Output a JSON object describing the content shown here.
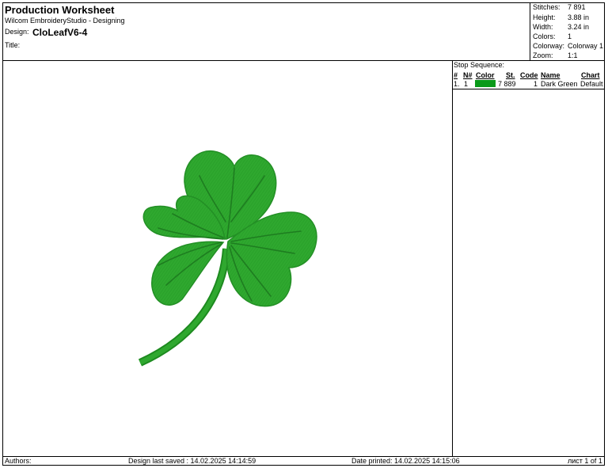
{
  "header": {
    "title": "Production Worksheet",
    "software": "Wilcom EmbroideryStudio - Designing",
    "design_label": "Design:",
    "design_value": "CloLeafV6-4",
    "title_label": "Title:"
  },
  "stats": [
    {
      "label": "Stitches:",
      "value": "7 891"
    },
    {
      "label": "Height:",
      "value": "3.88 in"
    },
    {
      "label": "Width:",
      "value": "3.24 in"
    },
    {
      "label": "Colors:",
      "value": "1"
    },
    {
      "label": "Colorway:",
      "value": "Colorway 1"
    },
    {
      "label": "Zoom:",
      "value": "1:1"
    }
  ],
  "stop_sequence": {
    "title": "Stop Sequence:",
    "headers": {
      "num": "#",
      "n": "N#",
      "color": "Color",
      "st": "St.",
      "code": "Code",
      "name": "Name",
      "chart": "Chart"
    },
    "rows": [
      {
        "num": "1.",
        "n": "1",
        "color_hex": "#0a9a1a",
        "st": "7 889",
        "code": "1",
        "name": "Dark Green",
        "chart": "Default"
      }
    ]
  },
  "footer": {
    "authors": "Authors:",
    "saved": "Design last saved : 14.02.2025 14:14:59",
    "printed": "Date printed: 14.02.2025 14:15:06",
    "page": "лист 1 of 1"
  },
  "design_colors": {
    "thread": "#2fa82f",
    "thread_dark": "#1d8a1f",
    "vein": "#1e7d20"
  }
}
